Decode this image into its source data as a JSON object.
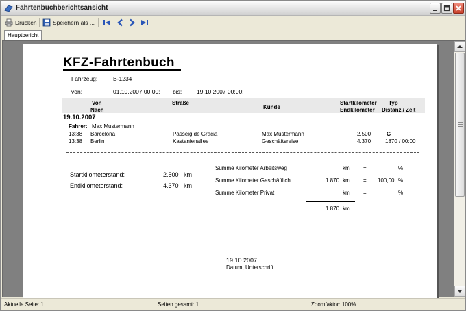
{
  "window": {
    "title": "Fahrtenbuchberichtsansicht"
  },
  "toolbar": {
    "print_label": "Drucken",
    "save_label": "Speichern als ..."
  },
  "tabs": [
    {
      "label": "Hauptbericht"
    }
  ],
  "report": {
    "title": "KFZ-Fahrtenbuch",
    "vehicle_label": "Fahrzeug:",
    "vehicle_value": "B-1234",
    "from_label": "von:",
    "from_value": "01.10.2007 00:00:",
    "to_label": "bis:",
    "to_value": "19.10.2007 00:00:",
    "columns": {
      "von": "Von",
      "nach": "Nach",
      "strasse": "Straße",
      "kunde": "Kunde",
      "startkm": "Startkilometer",
      "endkm": "Endkilometer",
      "typ": "Typ",
      "distanz": "Distanz / Zeit"
    },
    "group_date": "19.10.2007",
    "driver_label": "Fahrer:",
    "driver_value": "Max Mustermann",
    "rows": [
      {
        "time": "13:38",
        "place": "Barcelona",
        "street": "Passeig de Gracia",
        "customer": "Max Mustermann",
        "km": "2.500",
        "type": "G"
      },
      {
        "time": "13:38",
        "place": "Berlin",
        "street": "Kastanienallee",
        "customer": "Geschäftsreise",
        "km": "4.370",
        "type": "1870 / 00:00"
      }
    ],
    "summary": {
      "start_label": "Startkilometerstand:",
      "start_value": "2.500",
      "start_unit": "km",
      "end_label": "Endkilometerstand:",
      "end_value": "4.370",
      "end_unit": "km",
      "lines": [
        {
          "label": "Summe Kilometer Arbeitsweg",
          "value": "",
          "unit": "km",
          "eq": "=",
          "pct": "",
          "pct_unit": "%"
        },
        {
          "label": "Summe Kilometer Geschäftlich",
          "value": "1.870",
          "unit": "km",
          "eq": "=",
          "pct": "100,00",
          "pct_unit": "%"
        },
        {
          "label": "Summe Kilometer Privat",
          "value": "",
          "unit": "km",
          "eq": "=",
          "pct": "",
          "pct_unit": "%"
        }
      ],
      "total_value": "1.870",
      "total_unit": "km"
    },
    "signature_date": "19.10.2007",
    "signature_label": "Datum, Unterschrift"
  },
  "status": {
    "current_page": "Aktuelle Seite: 1",
    "total_pages": "Seiten gesamt: 1",
    "zoom": "Zoomfaktor: 100%"
  }
}
